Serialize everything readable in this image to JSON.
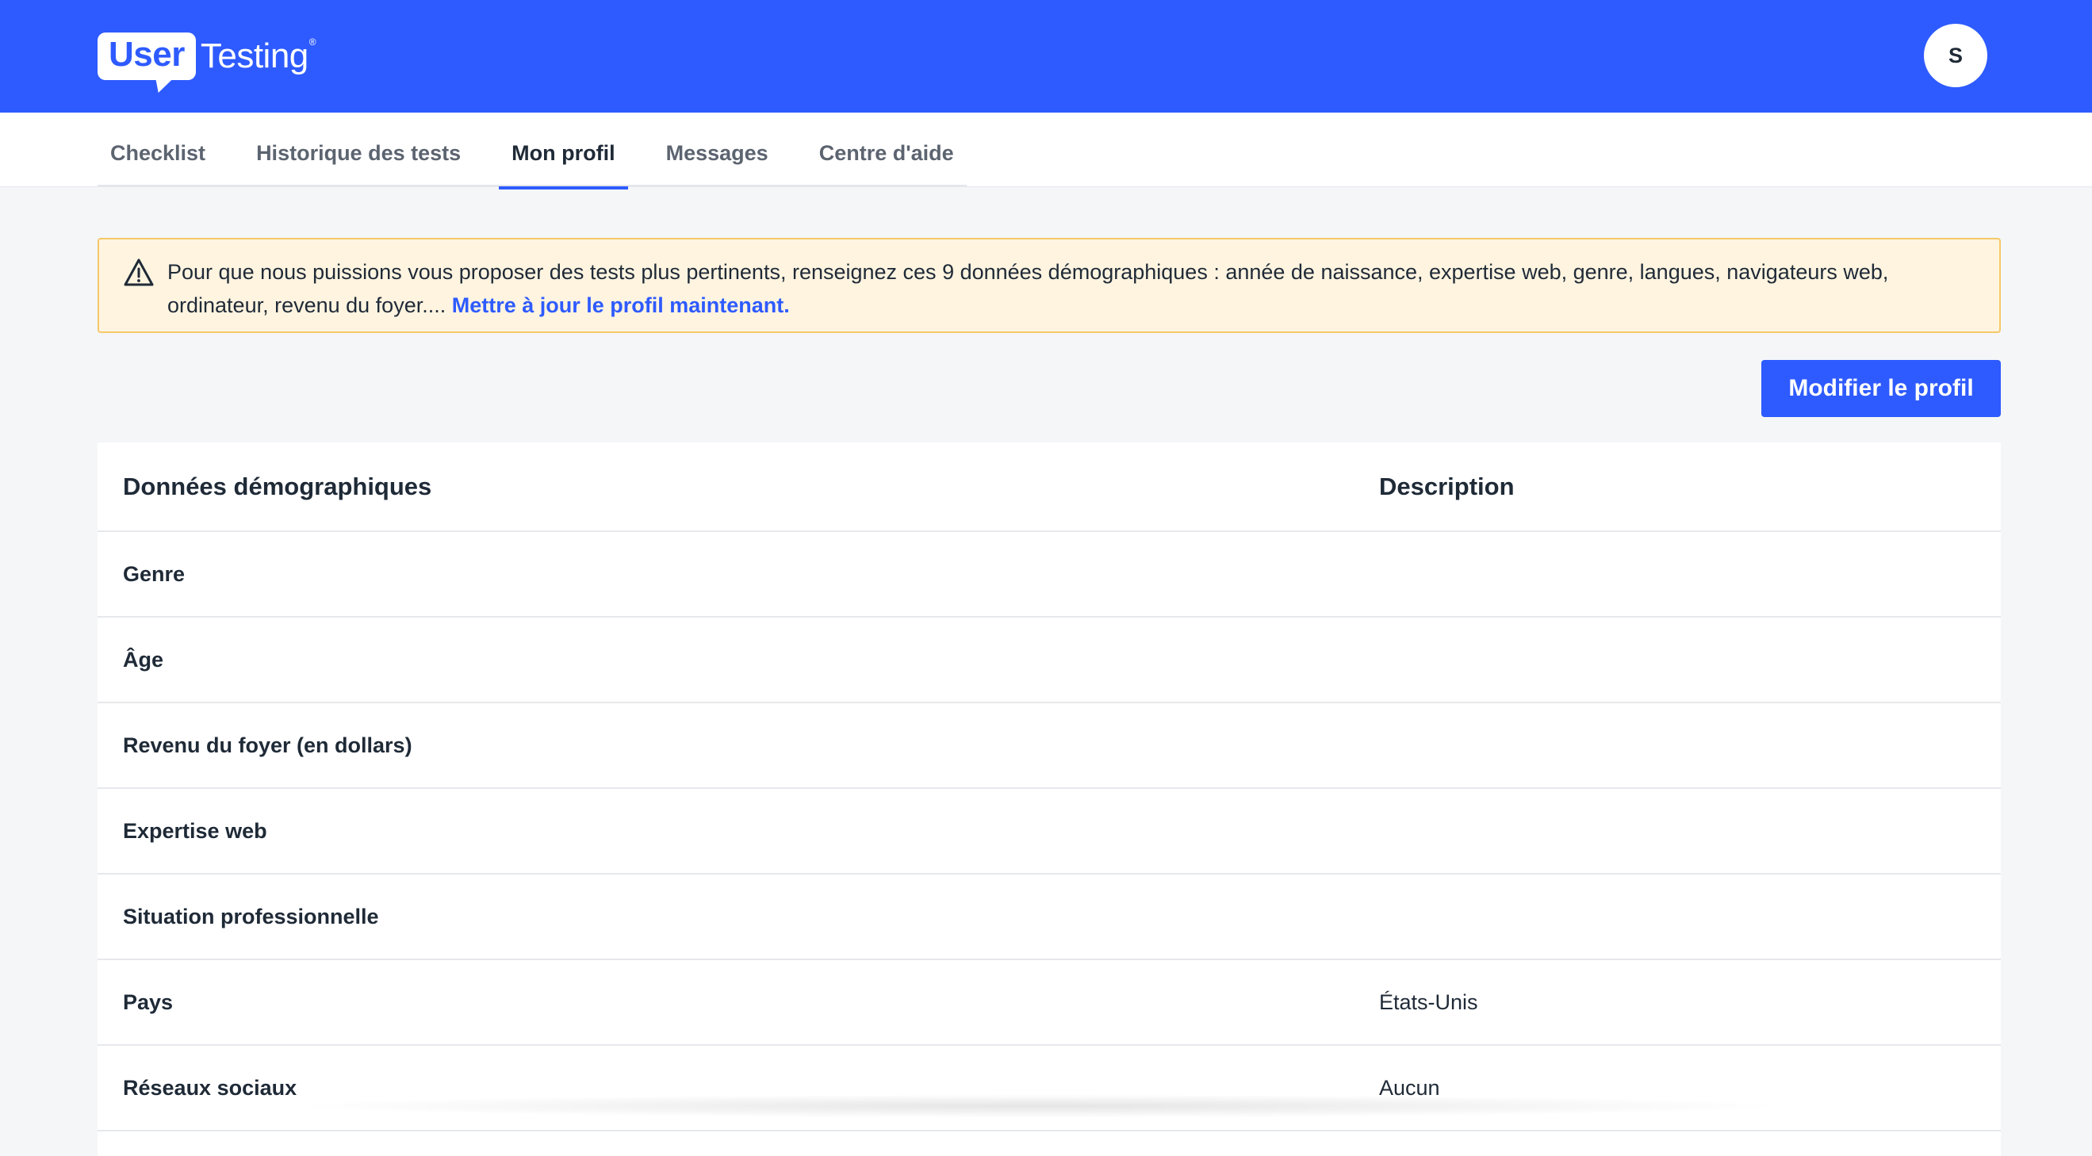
{
  "header": {
    "logo_user": "User",
    "logo_testing": "Testing",
    "logo_reg": "®",
    "avatar_initial": "S",
    "brand_color": "#2e5bff"
  },
  "nav": {
    "tabs": [
      {
        "label": "Checklist",
        "active": false
      },
      {
        "label": "Historique des tests",
        "active": false
      },
      {
        "label": "Mon profil",
        "active": true
      },
      {
        "label": "Messages",
        "active": false
      },
      {
        "label": "Centre d'aide",
        "active": false
      }
    ]
  },
  "alert": {
    "icon": "warning-triangle-icon",
    "text": "Pour que nous puissions vous proposer des tests plus pertinents, renseignez ces 9 données démographiques : année de naissance, expertise web, genre, langues, navigateurs web, ordinateur, revenu du foyer.... ",
    "link_label": "Mettre à jour le profil maintenant.",
    "background": "#fff4e0",
    "border": "#f5c869"
  },
  "actions": {
    "edit_profile_label": "Modifier le profil"
  },
  "table": {
    "headers": {
      "left": "Données démographiques",
      "right": "Description"
    },
    "rows": [
      {
        "label": "Genre",
        "value": ""
      },
      {
        "label": "Âge",
        "value": ""
      },
      {
        "label": "Revenu du foyer (en dollars)",
        "value": ""
      },
      {
        "label": "Expertise web",
        "value": ""
      },
      {
        "label": "Situation professionnelle",
        "value": ""
      },
      {
        "label": "Pays",
        "value": "États-Unis"
      },
      {
        "label": "Réseaux sociaux",
        "value": "Aucun"
      }
    ]
  }
}
